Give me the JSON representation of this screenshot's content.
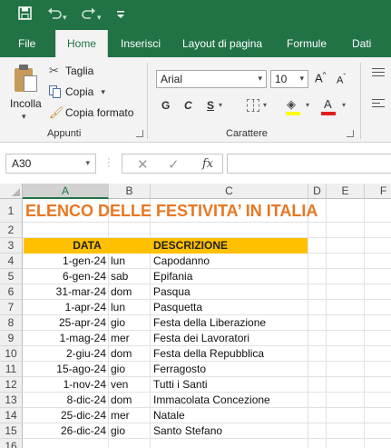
{
  "quick_access": {
    "save_icon": "save-icon",
    "undo_icon": "undo-icon",
    "redo_icon": "redo-icon",
    "customize_icon": "customize-icon"
  },
  "tabs": [
    {
      "label": "File"
    },
    {
      "label": "Home"
    },
    {
      "label": "Inserisci"
    },
    {
      "label": "Layout di pagina"
    },
    {
      "label": "Formule"
    },
    {
      "label": "Dati"
    }
  ],
  "ribbon": {
    "clipboard": {
      "paste_label": "Incolla",
      "cut_label": "Taglia",
      "copy_label": "Copia",
      "format_painter_label": "Copia formato",
      "group_label": "Appunti"
    },
    "font": {
      "font_name": "Arial",
      "font_size": "10",
      "grow_label": "A",
      "shrink_label": "A",
      "bold_label": "G",
      "italic_label": "C",
      "underline_label": "S",
      "color_label": "A",
      "group_label": "Carattere",
      "fill_color": "#ffff00",
      "font_color": "#e02020"
    }
  },
  "formula_bar": {
    "name_box": "A30",
    "cancel_icon": "✕",
    "enter_icon": "✓",
    "function_label": "fx",
    "content": ""
  },
  "sheet": {
    "columns": [
      "A",
      "B",
      "C",
      "D",
      "E",
      "F"
    ],
    "rows": [
      "1",
      "2",
      "3",
      "4",
      "5",
      "6",
      "7",
      "8",
      "9",
      "10",
      "11",
      "12",
      "13",
      "14",
      "15",
      "16"
    ],
    "title": "ELENCO DELLE FESTIVITA’ IN ITALIA",
    "title_color": "#e87722",
    "header_fill": "#ffc000",
    "header_date": "DATA",
    "header_description": "DESCRIZIONE",
    "holidays": [
      {
        "date": "1-gen-24",
        "day": "lun",
        "description": "Capodanno"
      },
      {
        "date": "6-gen-24",
        "day": "sab",
        "description": "Epifania"
      },
      {
        "date": "31-mar-24",
        "day": "dom",
        "description": "Pasqua"
      },
      {
        "date": "1-apr-24",
        "day": "lun",
        "description": "Pasquetta"
      },
      {
        "date": "25-apr-24",
        "day": "gio",
        "description": "Festa della Liberazione"
      },
      {
        "date": "1-mag-24",
        "day": "mer",
        "description": "Festa dei Lavoratori"
      },
      {
        "date": "2-giu-24",
        "day": "dom",
        "description": "Festa della Repubblica"
      },
      {
        "date": "15-ago-24",
        "day": "gio",
        "description": "Ferragosto"
      },
      {
        "date": "1-nov-24",
        "day": "ven",
        "description": "Tutti i Santi"
      },
      {
        "date": "8-dic-24",
        "day": "dom",
        "description": "Immacolata Concezione"
      },
      {
        "date": "25-dic-24",
        "day": "mer",
        "description": "Natale"
      },
      {
        "date": "26-dic-24",
        "day": "gio",
        "description": "Santo Stefano"
      }
    ]
  }
}
